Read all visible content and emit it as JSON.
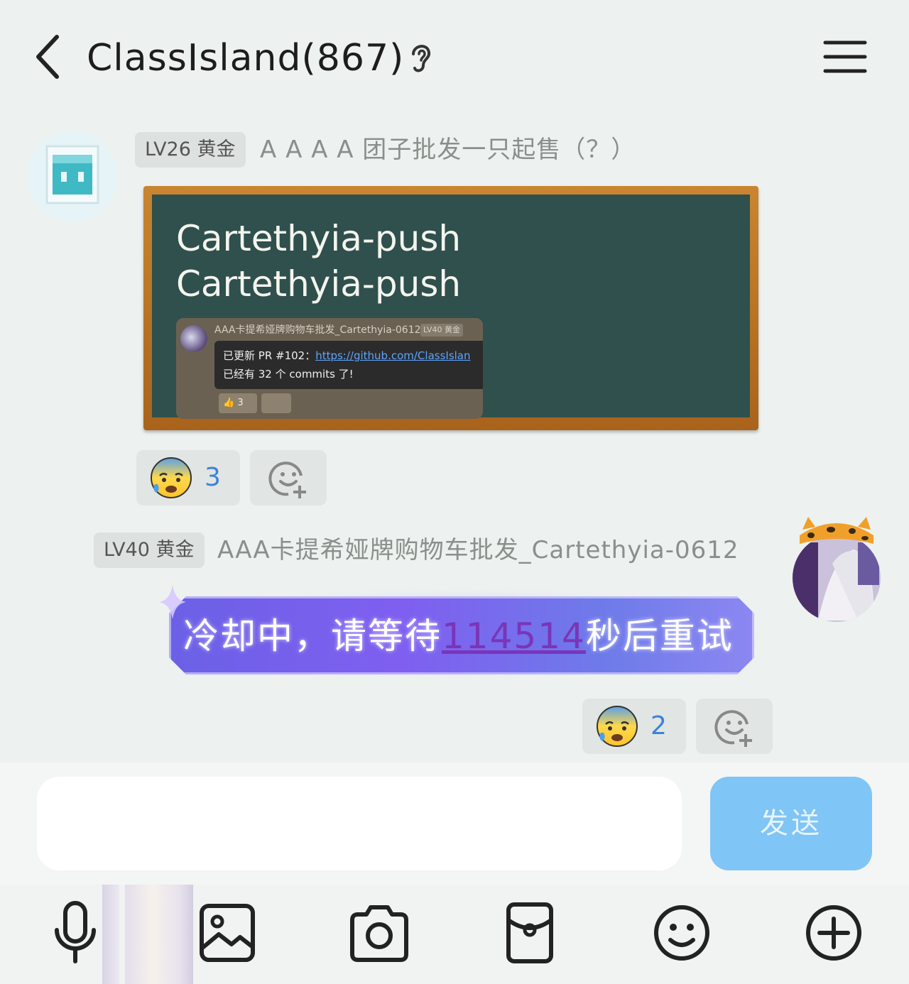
{
  "header": {
    "title": "ClassIsland(867)",
    "back_icon": "chevron-left-icon",
    "ear_icon": "ear-icon",
    "menu_icon": "hamburger-menu-icon"
  },
  "messages": [
    {
      "badge": "LV26 黄金",
      "nickname": "A A A A 团子批发一只起售（？）",
      "image": {
        "lines": [
          "Cartethyia-push",
          "Cartethyia-push"
        ],
        "quote": {
          "nickname": "AAA卡提希娅牌购物车批发_Cartethyia-0612",
          "badge": "LV40 黄金",
          "line1_prefix": "已更新 PR #102：",
          "line1_link": "https://github.com/ClassIslan",
          "line2": "已经有 32 个 commits 了!",
          "reaction_count": "3"
        }
      },
      "reaction": {
        "emoji": "anxious-sweat-emoji",
        "count": "3"
      }
    },
    {
      "badge": "LV40 黄金",
      "nickname": "AAA卡提希娅牌购物车批发_Cartethyia-0612",
      "text_prefix": "冷却中，请等待",
      "text_number": "114514",
      "text_suffix": "秒后重试",
      "reaction": {
        "emoji": "anxious-sweat-emoji",
        "count": "2"
      }
    }
  ],
  "input": {
    "value": "",
    "placeholder": ""
  },
  "send_label": "发送",
  "toolbar": [
    "microphone-icon",
    "image-icon",
    "camera-icon",
    "red-packet-icon",
    "emoji-icon",
    "plus-icon"
  ],
  "colors": {
    "background": "#edf1ef",
    "send_button": "#7fc5f5",
    "reaction_count": "#3c82d8",
    "blackboard": "#2f504c"
  }
}
